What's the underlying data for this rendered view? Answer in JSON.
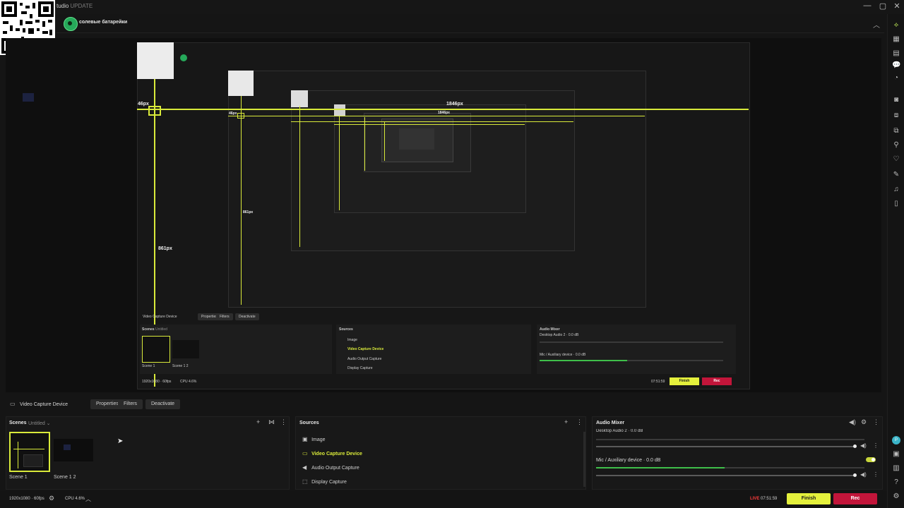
{
  "window": {
    "app_name": "tudio",
    "update_label": "UPDATE",
    "controls": {
      "minimize": "—",
      "maximize": "▢",
      "close": "✕"
    }
  },
  "header": {
    "channel_name": "солевые батарейки",
    "collapse_icon": "chevron-up-icon"
  },
  "preview": {
    "measure_46": "46px",
    "measure_1846": "1846px",
    "measure_861": "861px",
    "n_measure_46": "46px",
    "n_measure_1846": "1846px",
    "n_measure_861": "861px",
    "n_video_capture": "Video Capture Device",
    "n_properties": "Properties",
    "n_filters": "Filters",
    "n_deactivate": "Deactivate",
    "n_scenes": "Scenes",
    "n_untitled": "Untitled",
    "n_sources": "Sources",
    "n_audio_mixer": "Audio Mixer",
    "n_src_image": "Image",
    "n_src_video": "Video Capture Device",
    "n_src_audio": "Audio Output Capture",
    "n_src_display": "Display Capture",
    "n_scene1": "Scene 1",
    "n_scene12": "Scene 1 2",
    "n_mixer_desktop": "Desktop Audio 2 · 0.0 dB",
    "n_mixer_mic": "Mic / Auxiliary device · 0.0 dB",
    "n_res": "1920x1080 · 60fps",
    "n_cpu": "CPU 4.6%",
    "n_live_time": "07:51:59",
    "n_finish": "Finish",
    "n_rec": "Rec"
  },
  "toolbar": {
    "source_name": "Video Capture Device",
    "properties": "Properties",
    "filters": "Filters",
    "deactivate": "Deactivate"
  },
  "scenes": {
    "title": "Scenes",
    "collection": "Untitled",
    "items": [
      {
        "label": "Scene 1",
        "selected": true
      },
      {
        "label": "Scene 1 2",
        "selected": false
      }
    ]
  },
  "sources": {
    "title": "Sources",
    "items": [
      {
        "label": "Image",
        "icon": "image-icon",
        "selected": false
      },
      {
        "label": "Video Capture Device",
        "icon": "video-capture-icon",
        "selected": true
      },
      {
        "label": "Audio Output Capture",
        "icon": "speaker-icon",
        "selected": false
      },
      {
        "label": "Display Capture",
        "icon": "display-capture-icon",
        "selected": false
      }
    ]
  },
  "mixer": {
    "title": "Audio Mixer",
    "channels": [
      {
        "label": "Desktop Audio 2 · 0.0 dB",
        "level": 0.0,
        "volume": 0.97,
        "muted": false
      },
      {
        "label": "Mic / Auxiliary device · 0.0 dB",
        "level": 0.55,
        "volume": 0.97,
        "muted": false
      }
    ]
  },
  "status": {
    "resolution": "1920x1080 · 60fps",
    "cpu": "CPU 4.6%",
    "live_label": "LIVE",
    "live_time": "07:51:59",
    "finish": "Finish",
    "rec": "Rec"
  },
  "colors": {
    "accent": "#d9ea3a",
    "rec": "#c2153a",
    "live": "#ff3b3b",
    "meter": "#3fbf4a"
  }
}
